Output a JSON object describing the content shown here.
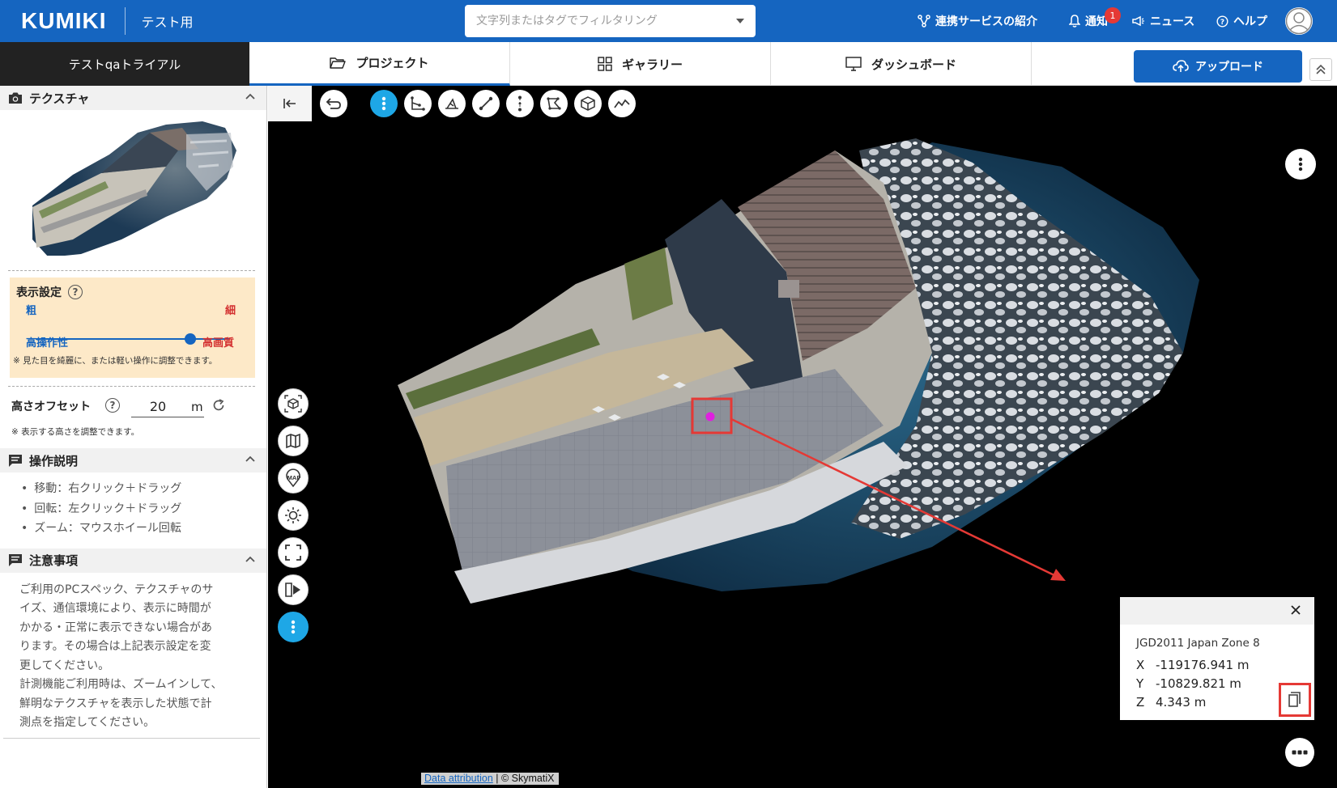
{
  "header": {
    "logo": "KUMIKI",
    "workspace": "テスト用",
    "search_placeholder": "文字列またはタグでフィルタリング",
    "links": {
      "integrations": "連携サービスの紹介",
      "notifications": "通知",
      "notification_count": "1",
      "news": "ニュース",
      "help": "ヘルプ"
    }
  },
  "nav": {
    "trial": "テストqaトライアル",
    "tabs": [
      {
        "label": "プロジェクト",
        "icon": "folder-icon",
        "active": true
      },
      {
        "label": "ギャラリー",
        "icon": "grid-icon",
        "active": false
      },
      {
        "label": "ダッシュボード",
        "icon": "monitor-icon",
        "active": false
      }
    ],
    "upload": "アップロード"
  },
  "sidebar": {
    "texture": {
      "title": "テクスチャ"
    },
    "display": {
      "title": "表示設定",
      "coarse": "粗",
      "fine": "細",
      "high_operability": "高操作性",
      "high_quality": "高画質",
      "slider_value": 0.85,
      "note": "※ 見た目を綺麗に、または軽い操作に調整できます。"
    },
    "height_offset": {
      "label": "高さオフセット",
      "value": "20",
      "unit": "m",
      "note": "※ 表示する高さを調整できます。"
    },
    "instructions": {
      "title": "操作説明",
      "items": [
        "移動：右クリック＋ドラッグ",
        "回転：左クリック＋ドラッグ",
        "ズーム：マウスホイール回転"
      ]
    },
    "caution": {
      "title": "注意事項",
      "lines": [
        "ご利用のPCスペック、テクスチャのサ",
        "イズ、通信環境により、表示に時間が",
        "かかる・正常に表示できない場合があ",
        "ります。その場合は上記表示設定を変",
        "更してください。",
        "計測機能ご利用時は、ズームインして、",
        "鮮明なテクスチャを表示した状態で計",
        "測点を指定してください。"
      ]
    }
  },
  "viewer": {
    "map_label": "MAP",
    "coords": {
      "system": "JGD2011 Japan Zone 8",
      "x_label": "X",
      "x": "-119176.941 m",
      "y_label": "Y",
      "y": "-10829.821 m",
      "z_label": "Z",
      "z": "4.343 m"
    },
    "attribution_link": "Data attribution",
    "attribution_text": "| © SkymatiX"
  }
}
